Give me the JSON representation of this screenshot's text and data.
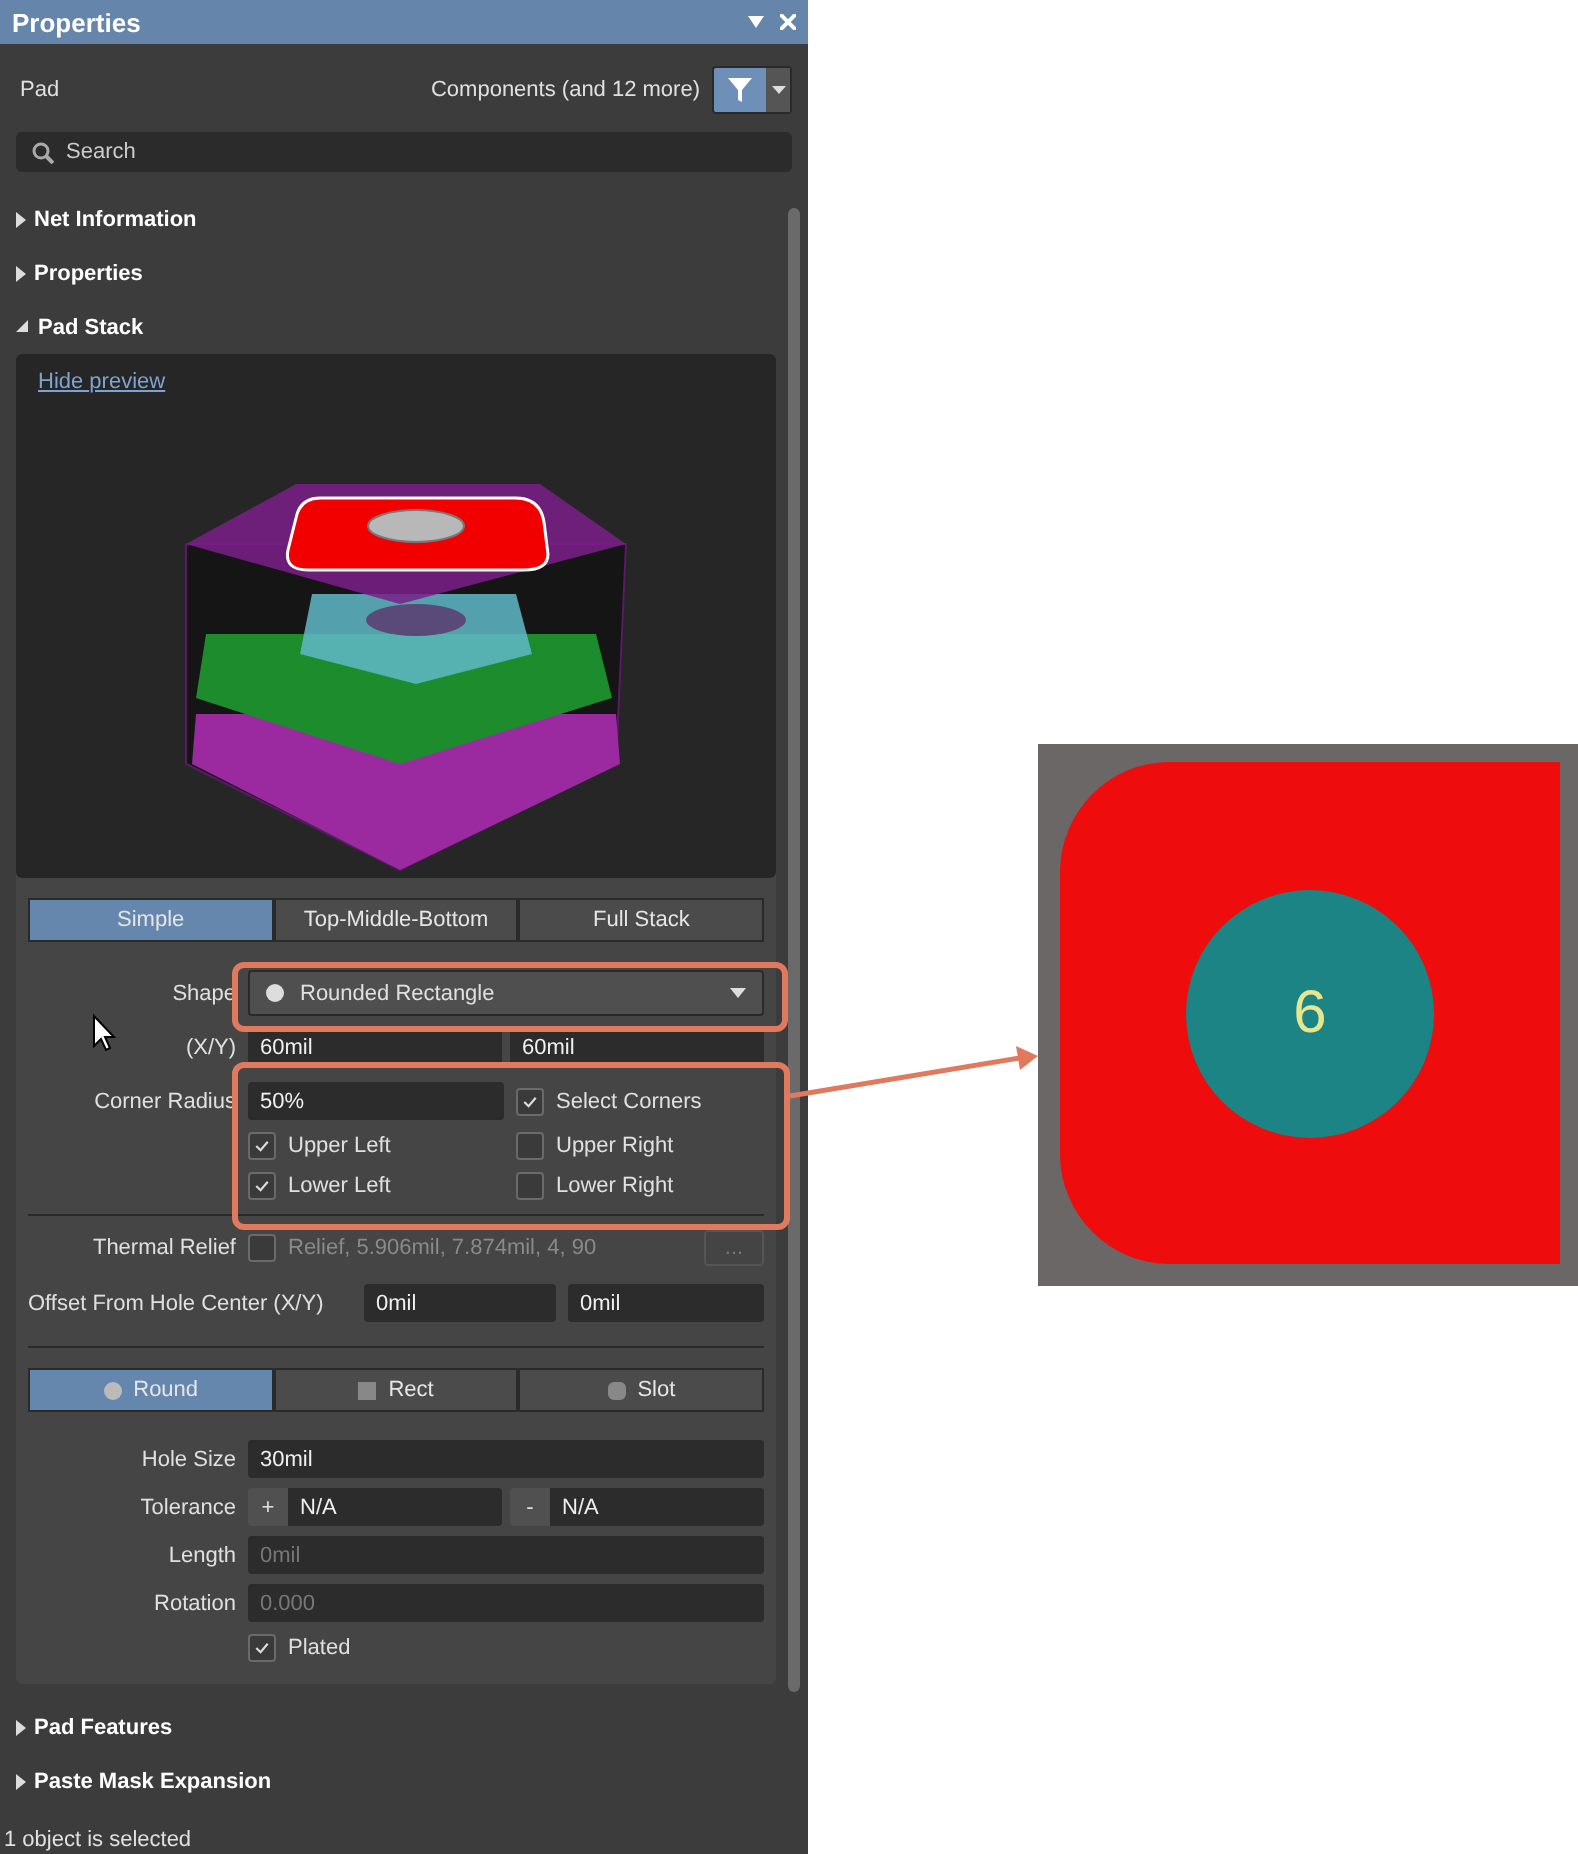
{
  "window": {
    "title": "Properties"
  },
  "header": {
    "object": "Pad",
    "filter": "Components (and 12 more)"
  },
  "search": {
    "placeholder": "Search"
  },
  "sections": [
    {
      "label": "Net Information",
      "expanded": false
    },
    {
      "label": "Properties",
      "expanded": false
    },
    {
      "label": "Pad Stack",
      "expanded": true
    }
  ],
  "pad_stack": {
    "preview_link": "Hide preview",
    "modes": [
      {
        "label": "Simple",
        "selected": true
      },
      {
        "label": "Top-Middle-Bottom",
        "selected": false
      },
      {
        "label": "Full Stack",
        "selected": false
      }
    ],
    "shape": {
      "label": "Shape",
      "value": "Rounded Rectangle"
    },
    "size": {
      "label": "(X/Y)",
      "x": "60mil",
      "y": "60mil"
    },
    "corner_radius": {
      "label": "Corner Radius",
      "value": "50%"
    },
    "select_corners": {
      "label": "Select Corners",
      "checked": true
    },
    "corners": [
      {
        "label": "Upper Left",
        "checked": true
      },
      {
        "label": "Upper Right",
        "checked": false
      },
      {
        "label": "Lower Left",
        "checked": true
      },
      {
        "label": "Lower Right",
        "checked": false
      }
    ],
    "thermal_relief": {
      "label": "Thermal Relief",
      "checked": false,
      "value": "Relief, 5.906mil, 7.874mil, 4, 90",
      "more": "...",
      "disabled": true
    },
    "offset": {
      "label": "Offset From Hole Center (X/Y)",
      "x": "0mil",
      "y": "0mil"
    },
    "hole_types": [
      {
        "label": "Round",
        "kind": "round",
        "selected": true
      },
      {
        "label": "Rect",
        "kind": "rect",
        "selected": false
      },
      {
        "label": "Slot",
        "kind": "slot",
        "selected": false
      }
    ],
    "hole_size": {
      "label": "Hole Size",
      "value": "30mil"
    },
    "tolerance": {
      "label": "Tolerance",
      "plus_sign": "+",
      "plus": "N/A",
      "minus_sign": "-",
      "minus": "N/A"
    },
    "length": {
      "label": "Length",
      "value": "0mil",
      "disabled": true
    },
    "rotation": {
      "label": "Rotation",
      "value": "0.000",
      "disabled": true
    },
    "plated": {
      "label": "Plated",
      "checked": true
    }
  },
  "more_sections": [
    {
      "label": "Pad Features",
      "expanded": false
    },
    {
      "label": "Paste Mask Expansion",
      "expanded": false
    }
  ],
  "status_bar": "1 object is selected",
  "callout": {
    "pad_number": "6"
  }
}
